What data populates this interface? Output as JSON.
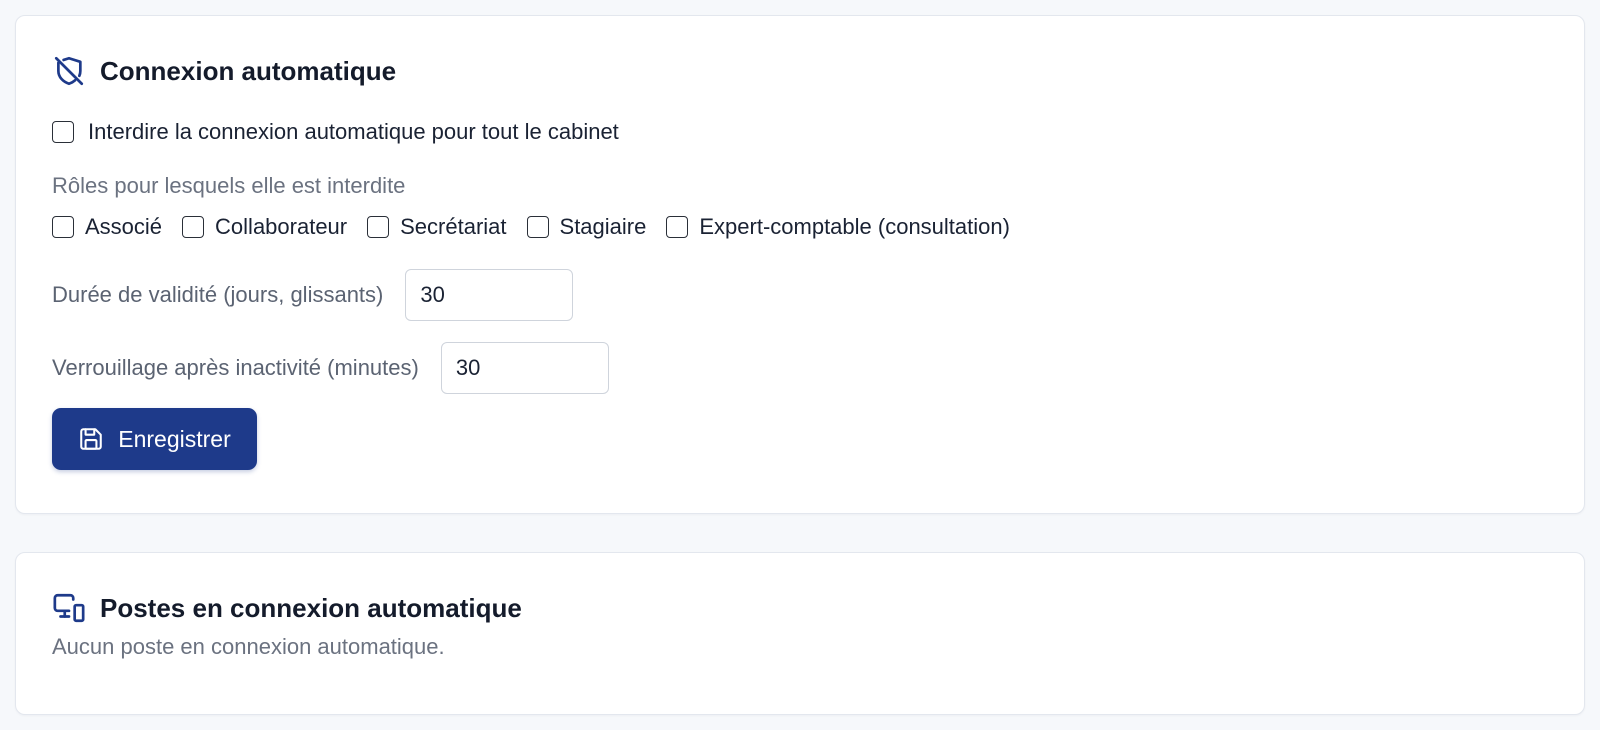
{
  "auto_login": {
    "title": "Connexion automatique",
    "icon": "shield-off-icon",
    "forbid_all": {
      "label": "Interdire la connexion automatique pour tout le cabinet",
      "checked": false
    },
    "roles_label": "Rôles pour lesquels elle est interdite",
    "roles": [
      {
        "label": "Associé",
        "checked": false
      },
      {
        "label": "Collaborateur",
        "checked": false
      },
      {
        "label": "Secrétariat",
        "checked": false
      },
      {
        "label": "Stagiaire",
        "checked": false
      },
      {
        "label": "Expert-comptable (consultation)",
        "checked": false
      }
    ],
    "validity": {
      "label": "Durée de validité (jours, glissants)",
      "value": "30"
    },
    "lock": {
      "label": "Verrouillage après inactivité (minutes)",
      "value": "30"
    },
    "save_button": {
      "label": "Enregistrer",
      "icon": "save-icon"
    }
  },
  "postes": {
    "title": "Postes en connexion automatique",
    "icon": "devices-icon",
    "empty_text": "Aucun poste en connexion automatique."
  },
  "colors": {
    "primary": "#1e3a8a",
    "text": "#1a2233",
    "muted": "#6b7280",
    "background": "#f6f8fb"
  }
}
